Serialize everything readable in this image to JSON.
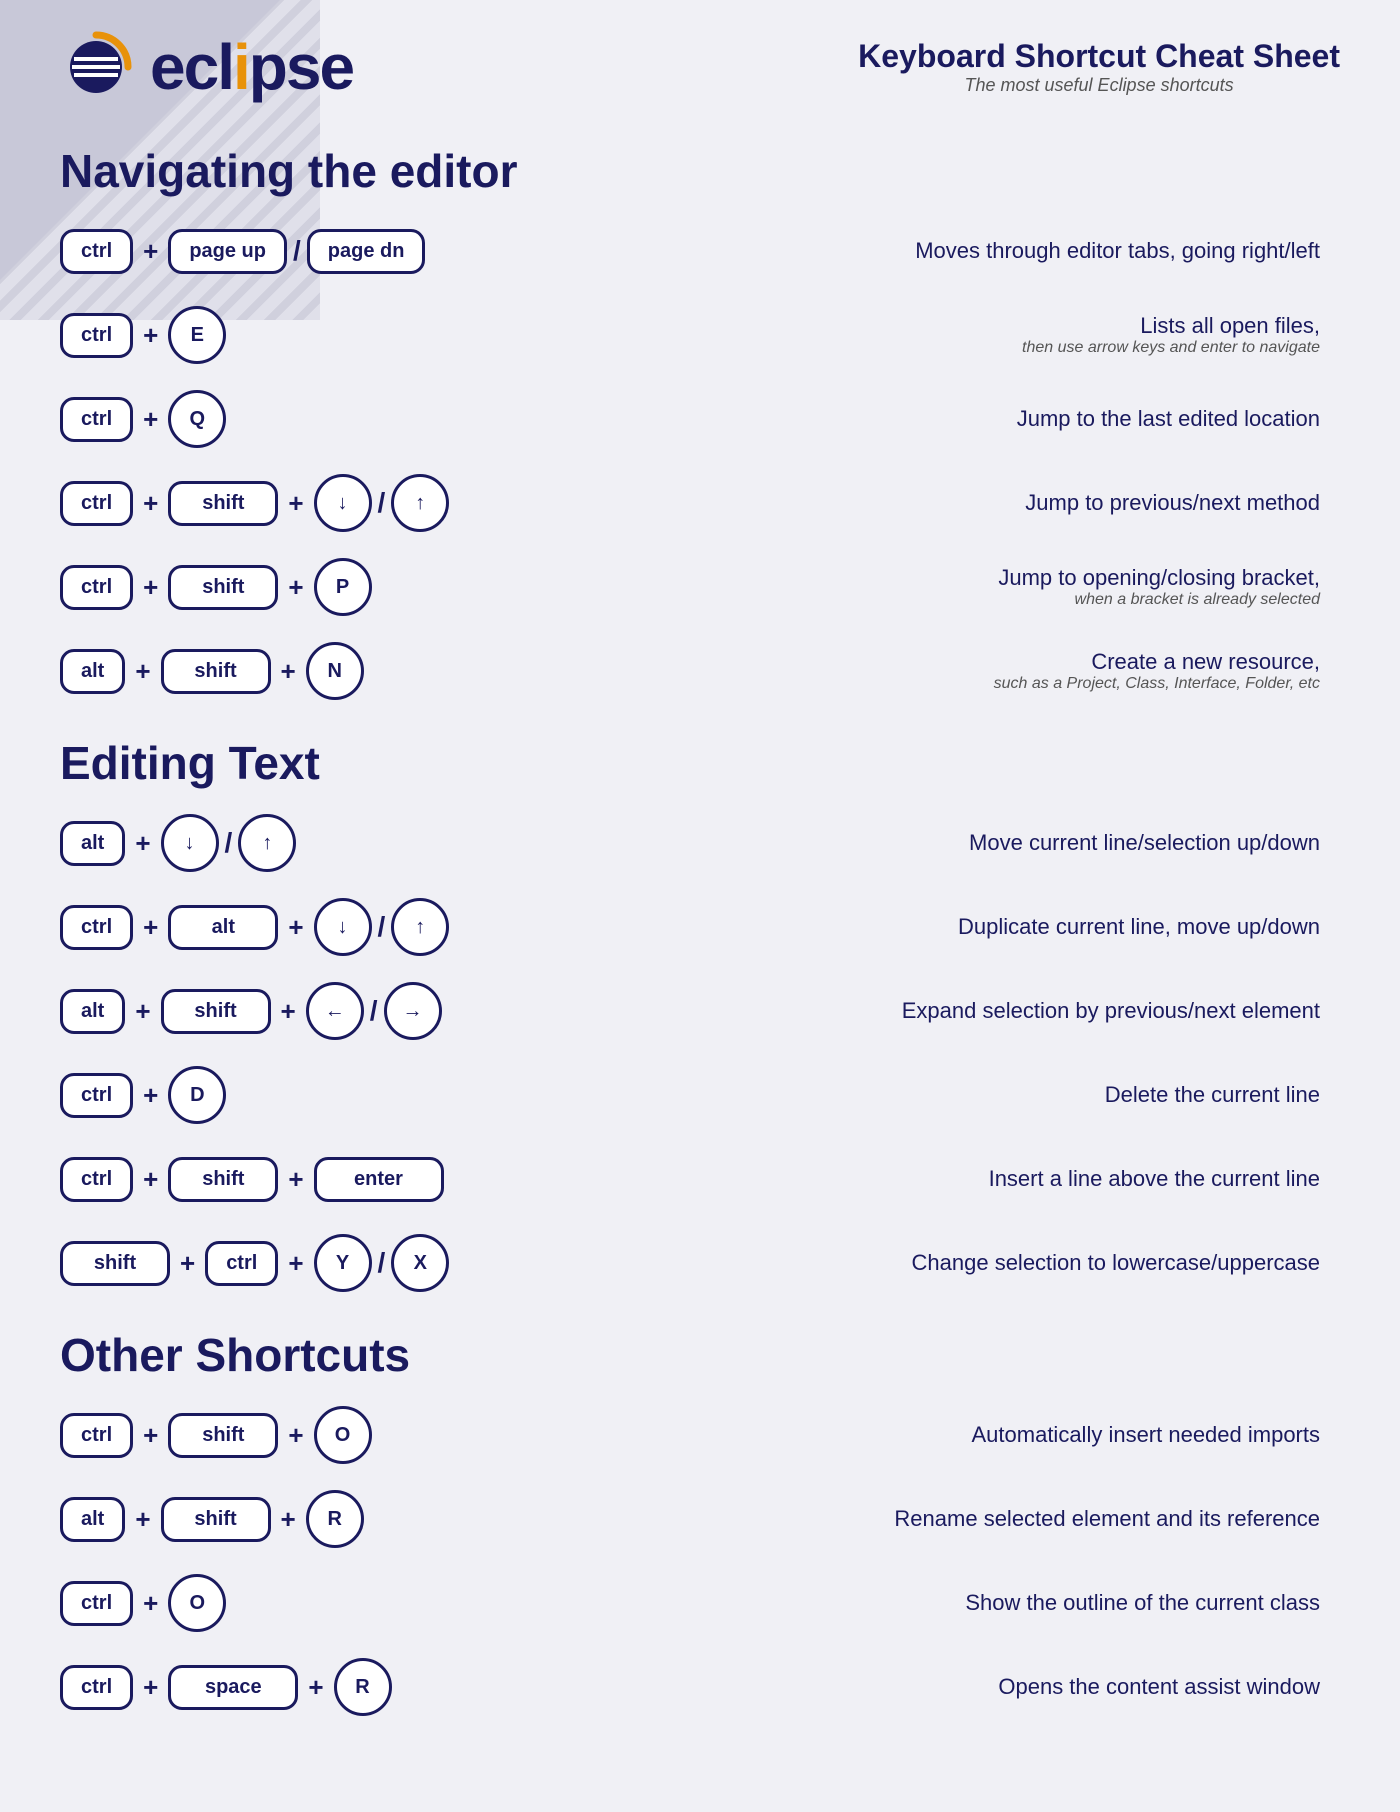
{
  "header": {
    "logo_text_before": "ecl",
    "logo_text_accent": "i",
    "logo_text_after": "pse",
    "title": "Keyboard Shortcut Cheat Sheet",
    "subtitle": "The most useful Eclipse shortcuts"
  },
  "sections": [
    {
      "id": "navigating",
      "title": "Navigating the editor",
      "shortcuts": [
        {
          "keys_display": "ctrl_pageup_pagedn",
          "description": "Moves through editor tabs, going right/left",
          "description_sub": ""
        },
        {
          "keys_display": "ctrl_E",
          "description": "Lists all open files,",
          "description_sub": "then use arrow keys and enter to navigate"
        },
        {
          "keys_display": "ctrl_Q",
          "description": "Jump to the last edited location",
          "description_sub": ""
        },
        {
          "keys_display": "ctrl_shift_down_up",
          "description": "Jump to previous/next method",
          "description_sub": ""
        },
        {
          "keys_display": "ctrl_shift_P",
          "description": "Jump to opening/closing bracket,",
          "description_sub": "when a bracket is already selected"
        },
        {
          "keys_display": "alt_shift_N",
          "description": "Create a new resource,",
          "description_sub": "such as a Project, Class, Interface, Folder, etc"
        }
      ]
    },
    {
      "id": "editing",
      "title": "Editing Text",
      "shortcuts": [
        {
          "keys_display": "alt_down_up",
          "description": "Move current line/selection up/down",
          "description_sub": ""
        },
        {
          "keys_display": "ctrl_alt_down_up",
          "description": "Duplicate current line, move up/down",
          "description_sub": ""
        },
        {
          "keys_display": "alt_shift_left_right",
          "description": "Expand selection by previous/next element",
          "description_sub": ""
        },
        {
          "keys_display": "ctrl_D",
          "description": "Delete the current line",
          "description_sub": ""
        },
        {
          "keys_display": "ctrl_shift_enter",
          "description": "Insert a line above the current line",
          "description_sub": ""
        },
        {
          "keys_display": "shift_ctrl_Y_X",
          "description": "Change selection to lowercase/uppercase",
          "description_sub": ""
        }
      ]
    },
    {
      "id": "other",
      "title": "Other Shortcuts",
      "shortcuts": [
        {
          "keys_display": "ctrl_shift_O",
          "description": "Automatically insert needed imports",
          "description_sub": ""
        },
        {
          "keys_display": "alt_shift_R",
          "description": "Rename selected element and its reference",
          "description_sub": ""
        },
        {
          "keys_display": "ctrl_O",
          "description": "Show the outline of the current class",
          "description_sub": ""
        },
        {
          "keys_display": "ctrl_space_R",
          "description": "Opens the content assist window",
          "description_sub": ""
        }
      ]
    }
  ],
  "labels": {
    "ctrl": "ctrl",
    "alt": "alt",
    "shift": "shift",
    "page_up": "page up",
    "page_dn": "page dn",
    "enter": "enter",
    "space": "space",
    "plus": "+",
    "slash": "/",
    "E": "E",
    "Q": "Q",
    "P": "P",
    "N": "N",
    "D": "D",
    "O": "O",
    "R": "R",
    "Y": "Y",
    "X": "X"
  }
}
